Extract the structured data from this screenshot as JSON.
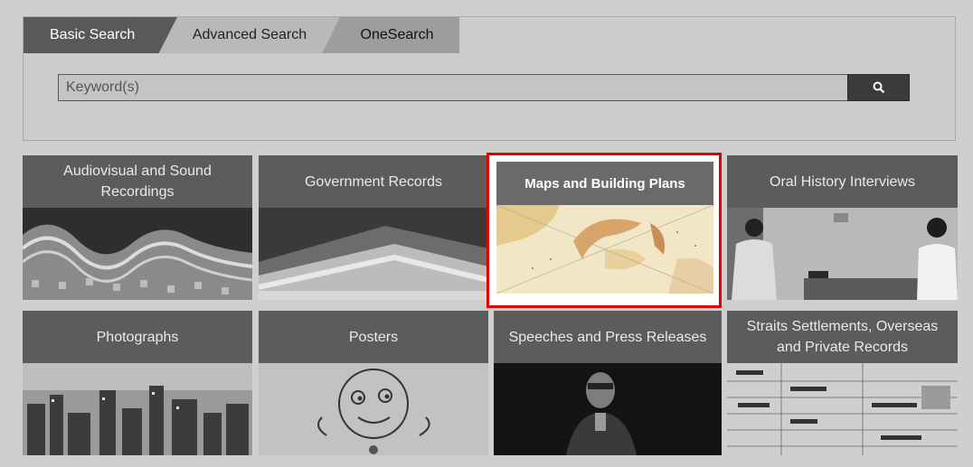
{
  "search": {
    "tabs": [
      {
        "label": "Basic Search"
      },
      {
        "label": "Advanced Search"
      },
      {
        "label": "OneSearch"
      }
    ],
    "placeholder": "Keyword(s)",
    "button_icon": "search-icon"
  },
  "categories": [
    {
      "label": "Audiovisual and Sound Recordings"
    },
    {
      "label": "Government Records"
    },
    {
      "label": "Maps and Building Plans",
      "selected": true
    },
    {
      "label": "Oral History Interviews"
    },
    {
      "label": "Photographs"
    },
    {
      "label": "Posters"
    },
    {
      "label": "Speeches and Press Releases"
    },
    {
      "label": "Straits Settlements, Overseas and Private Records"
    }
  ],
  "colors": {
    "highlight": "#e00000",
    "tile_header": "#5c5c5c",
    "background": "#cfcfcf"
  }
}
